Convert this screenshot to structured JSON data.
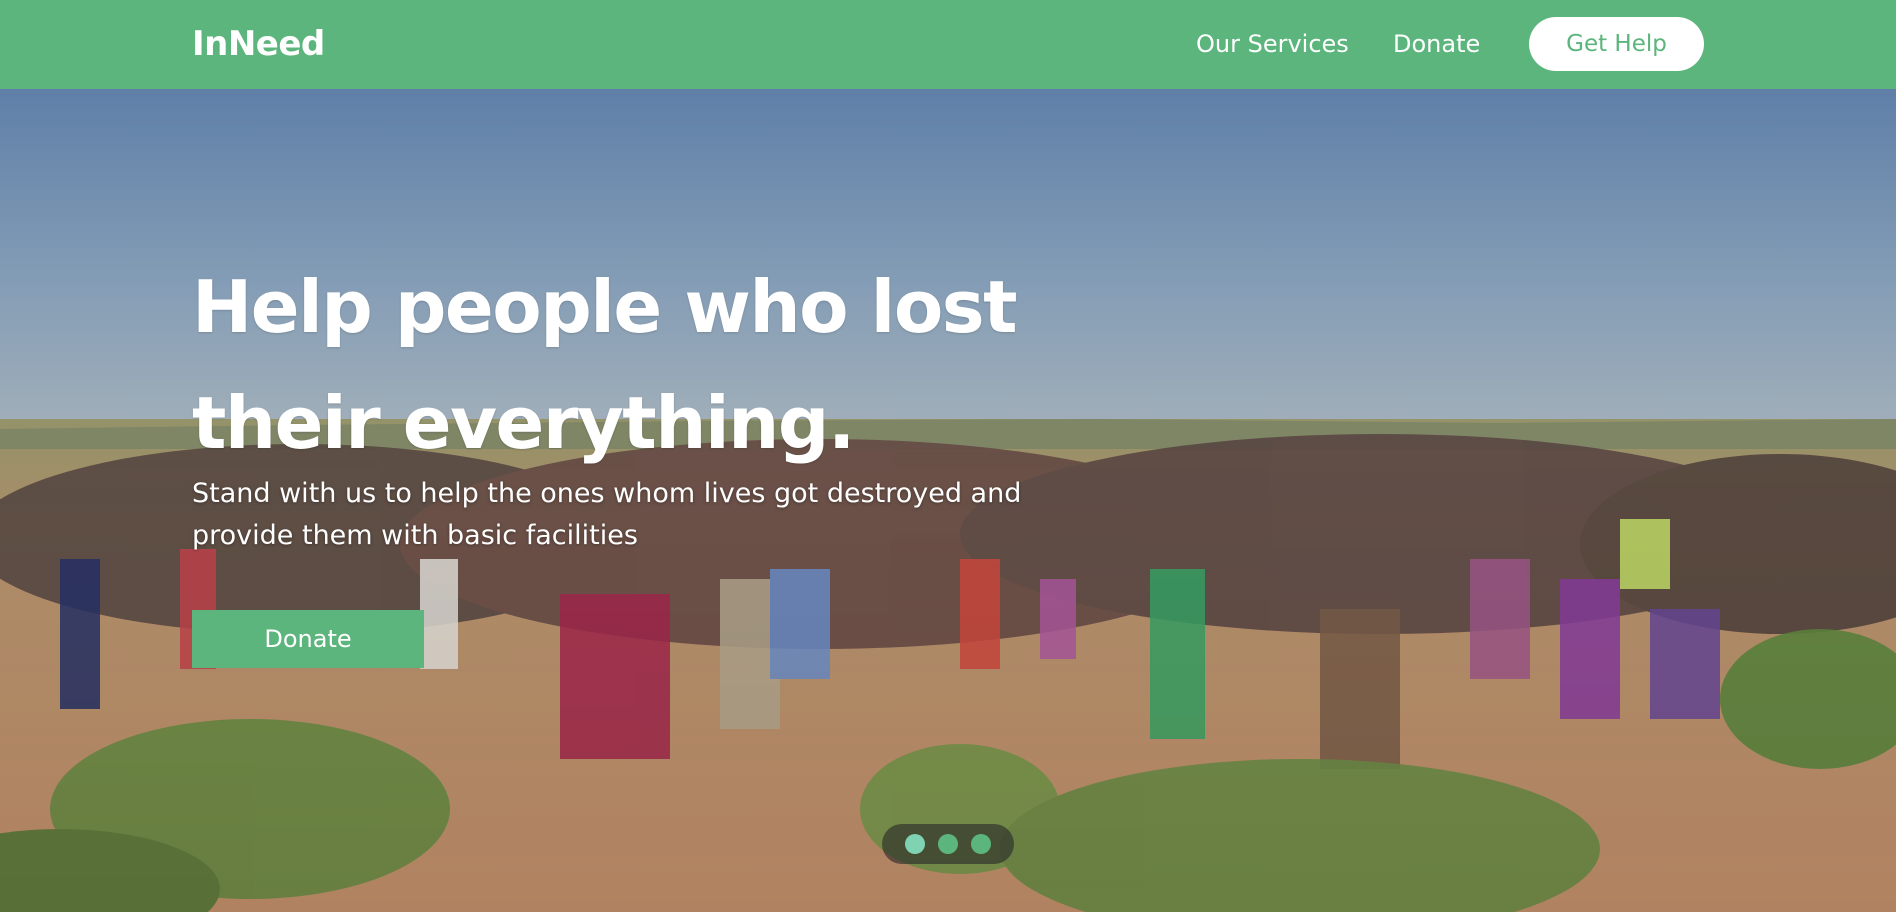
{
  "nav": {
    "logo": "InNeed",
    "links": [
      {
        "label": "Our Services"
      },
      {
        "label": "Donate"
      }
    ],
    "cta_label": "Get Help"
  },
  "hero": {
    "title": "Help people who lost their everything.",
    "subtitle": "Stand with us to help the ones whom lives got destroyed and provide them with basic facilities",
    "button_label": "Donate",
    "image_description": "crowd of people gathered in an arid field under a blue sky",
    "carousel": {
      "count": 3,
      "active_index": 0
    }
  },
  "colors": {
    "brand_green": "#5cb57c",
    "active_dot": "#7fd3b2",
    "white": "#ffffff"
  }
}
